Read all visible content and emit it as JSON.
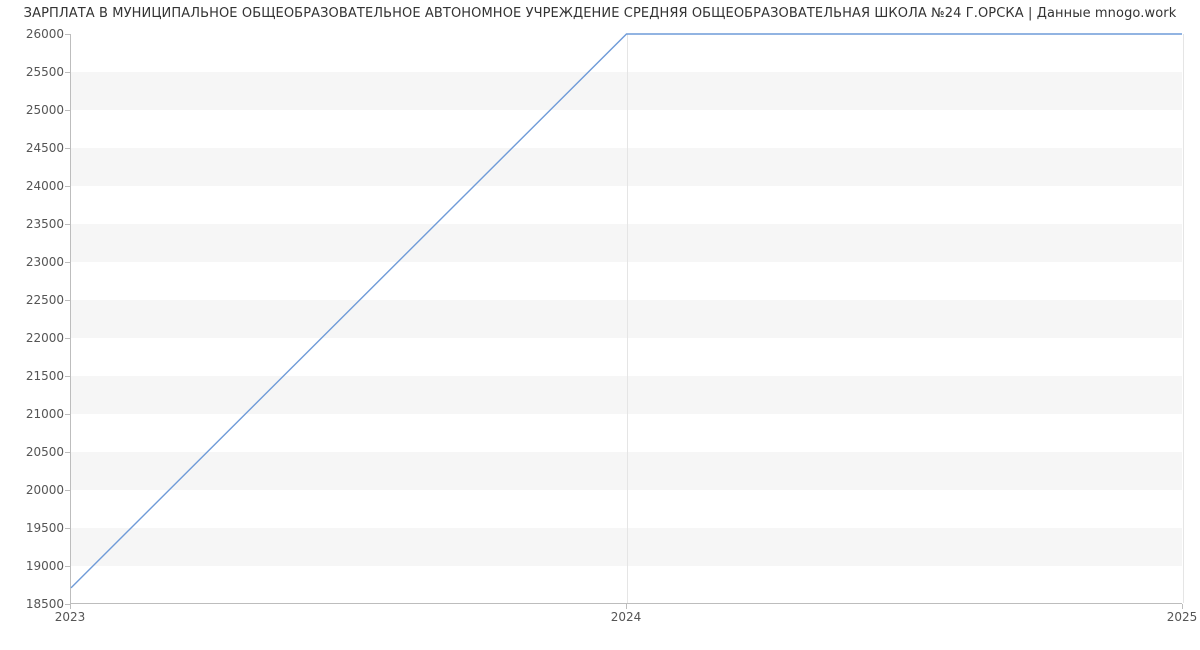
{
  "chart_data": {
    "type": "line",
    "title": "ЗАРПЛАТА В МУНИЦИПАЛЬНОЕ ОБЩЕОБРАЗОВАТЕЛЬНОЕ АВТОНОМНОЕ УЧРЕЖДЕНИЕ СРЕДНЯЯ ОБЩЕОБРАЗОВАТЕЛЬНАЯ ШКОЛА №24 Г.ОРСКА | Данные mnogo.work",
    "xlabel": "",
    "ylabel": "",
    "x": [
      2023,
      2024,
      2025
    ],
    "series": [
      {
        "name": "salary",
        "values": [
          18700,
          26000,
          26000
        ]
      }
    ],
    "xlim": [
      2023,
      2025
    ],
    "ylim": [
      18500,
      26000
    ],
    "y_ticks": [
      18500,
      19000,
      19500,
      20000,
      20500,
      21000,
      21500,
      22000,
      22500,
      23000,
      23500,
      24000,
      24500,
      25000,
      25500,
      26000
    ],
    "x_ticks": [
      2023,
      2024,
      2025
    ]
  },
  "colors": {
    "line": "#6f9bd8",
    "band": "#f6f6f6",
    "grid": "#e5e5e5",
    "axis": "#bdbdbd",
    "text": "#333333"
  }
}
